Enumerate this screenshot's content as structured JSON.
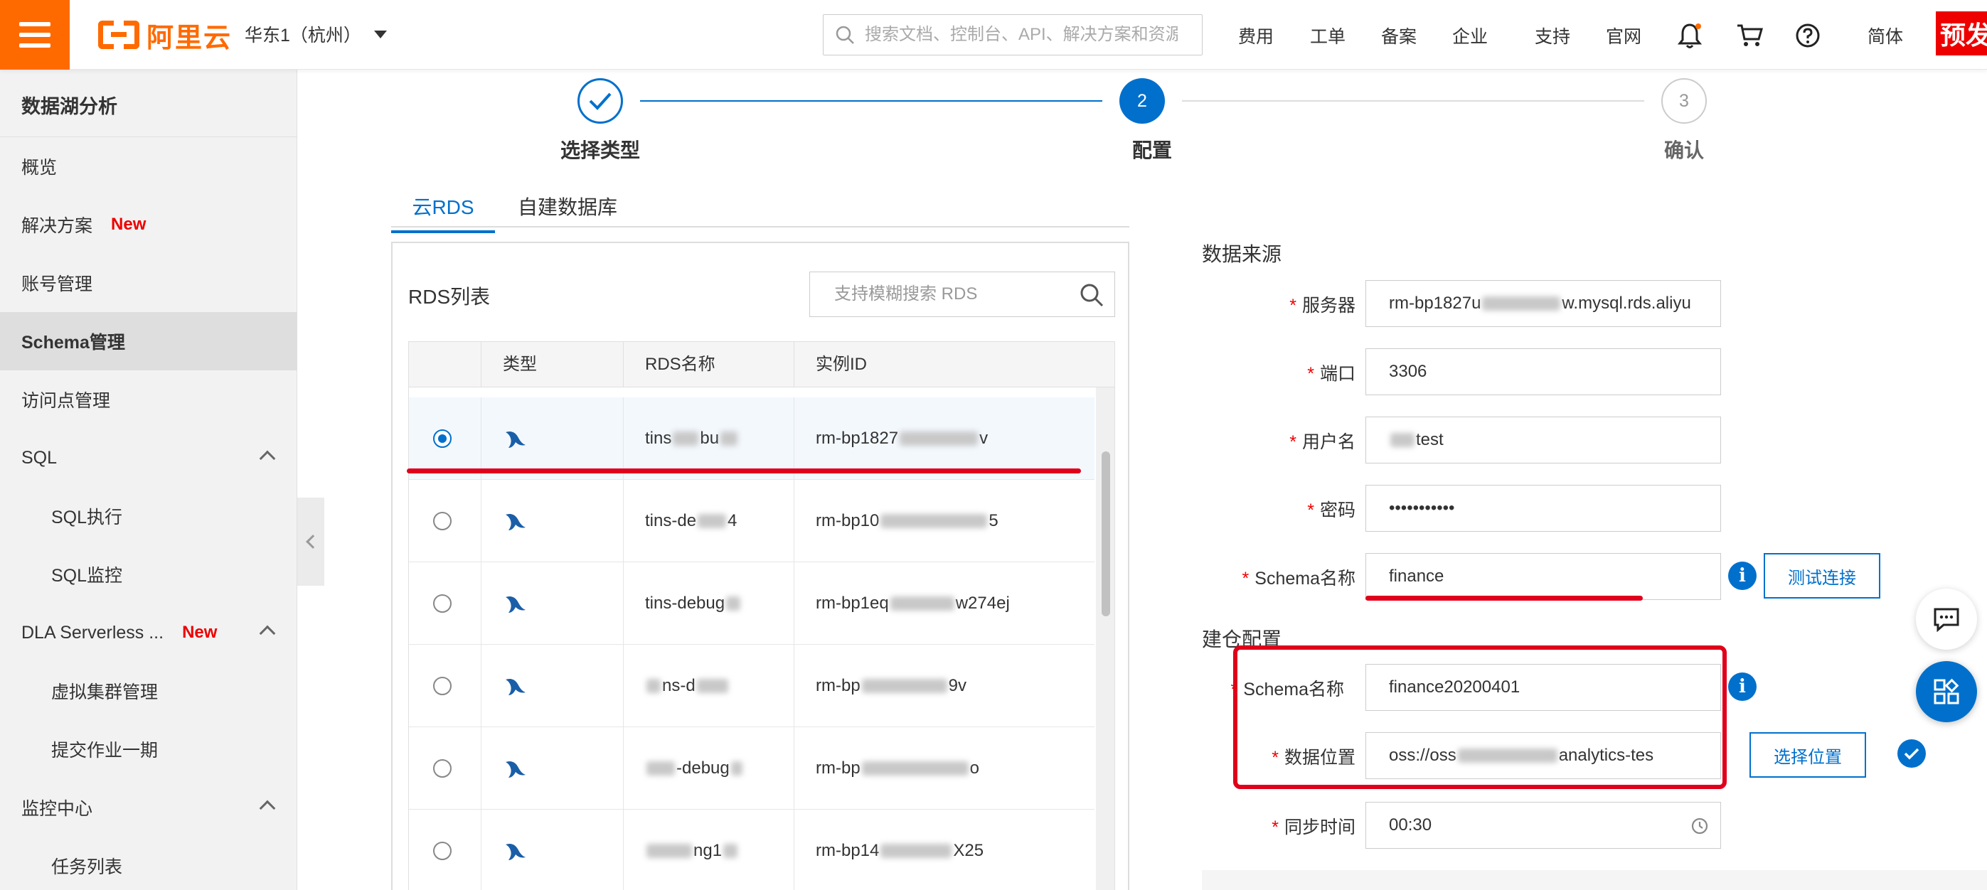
{
  "topbar": {
    "logo_text": "阿里云",
    "region": "华东1（杭州）",
    "search_placeholder": "搜索文档、控制台、API、解决方案和资源",
    "links": [
      "费用",
      "工单",
      "备案",
      "企业",
      "支持",
      "官网"
    ],
    "language": "简体",
    "preview_badge": "预发"
  },
  "sidebar": {
    "title": "数据湖分析",
    "items": [
      {
        "label": "概览"
      },
      {
        "label": "解决方案",
        "badge": "New"
      },
      {
        "label": "账号管理"
      },
      {
        "label": "Schema管理"
      },
      {
        "label": "访问点管理"
      },
      {
        "label": "SQL"
      },
      {
        "label": "SQL执行"
      },
      {
        "label": "SQL监控"
      },
      {
        "label": "DLA Serverless ...",
        "badge": "New"
      },
      {
        "label": "虚拟集群管理"
      },
      {
        "label": "提交作业一期"
      },
      {
        "label": "监控中心"
      },
      {
        "label": "任务列表"
      }
    ]
  },
  "steps": [
    {
      "number": "",
      "label": "选择类型"
    },
    {
      "number": "2",
      "label": "配置"
    },
    {
      "number": "3",
      "label": "确认"
    }
  ],
  "tabs": [
    "云RDS",
    "自建数据库"
  ],
  "rds": {
    "title": "RDS列表",
    "search_placeholder": "支持模糊搜索 RDS",
    "columns": [
      "类型",
      "RDS名称",
      "实例ID"
    ],
    "rows": [
      {
        "name": "tins",
        "name_tail": "bu",
        "instance": "rm-bp1827",
        "instance_tail": "v"
      },
      {
        "name": "tins-de",
        "name_tail": "4",
        "instance": "rm-bp10",
        "instance_tail": "5"
      },
      {
        "name": "tins-debug",
        "name_tail": "",
        "instance": "rm-bp1eq",
        "instance_tail": "w274ej"
      },
      {
        "name": "ns-d",
        "name_tail": "",
        "instance": "rm-bp",
        "instance_tail": "9v"
      },
      {
        "name": "-debug",
        "name_tail": "",
        "instance": "rm-bp",
        "instance_tail": "o"
      },
      {
        "name": "ng1",
        "name_tail": "",
        "instance": "rm-bp14",
        "instance_tail": "X25"
      }
    ]
  },
  "form": {
    "source_title": "数据来源",
    "fields": {
      "server": {
        "label": "服务器",
        "value_head": "rm-bp1827u",
        "value_tail": "w.mysql.rds.aliyu"
      },
      "port": {
        "label": "端口",
        "value": "3306"
      },
      "username": {
        "label": "用户名",
        "value": "test"
      },
      "password": {
        "label": "密码",
        "value": "•••••••••••"
      },
      "schema": {
        "label": "Schema名称",
        "value": "finance"
      }
    },
    "test_button": "测试连接",
    "warehouse_title": "建仓配置",
    "warehouse": {
      "schema": {
        "label": "Schema名称",
        "value": "finance20200401"
      },
      "location": {
        "label": "数据位置",
        "value_head": "oss://oss",
        "value_tail": "analytics-tes"
      },
      "sync": {
        "label": "同步时间",
        "value": "00:30"
      }
    },
    "select_location_button": "选择位置"
  },
  "colors": {
    "accent": "#0070cc",
    "brand": "#ff6a00",
    "highlight": "#e0001b"
  }
}
